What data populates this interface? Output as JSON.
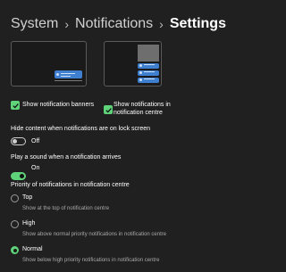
{
  "breadcrumb": {
    "items": [
      "System",
      "Notifications",
      "Settings"
    ],
    "separator": "›"
  },
  "checkboxes": {
    "banners": {
      "label": "Show notification banners",
      "checked": true
    },
    "centre": {
      "label_line1": "Show notifications in",
      "label_line2": "notification centre",
      "checked": true
    }
  },
  "lock_screen": {
    "heading": "Hide content when notifications are on lock screen",
    "state": "Off"
  },
  "sound": {
    "heading": "Play a sound when a notification arrives",
    "state": "On"
  },
  "priority": {
    "heading": "Priority of notifications in notification centre",
    "options": [
      {
        "label": "Top",
        "description": "Show at the top of notification centre",
        "selected": false
      },
      {
        "label": "High",
        "description": "Show above normal priority notifications in notification centre",
        "selected": false
      },
      {
        "label": "Normal",
        "description": "Show below high priority notifications in notification centre",
        "selected": true
      }
    ]
  },
  "colors": {
    "accent": "#5fd37a",
    "toast": "#3f7fd0",
    "background": "#202020"
  }
}
